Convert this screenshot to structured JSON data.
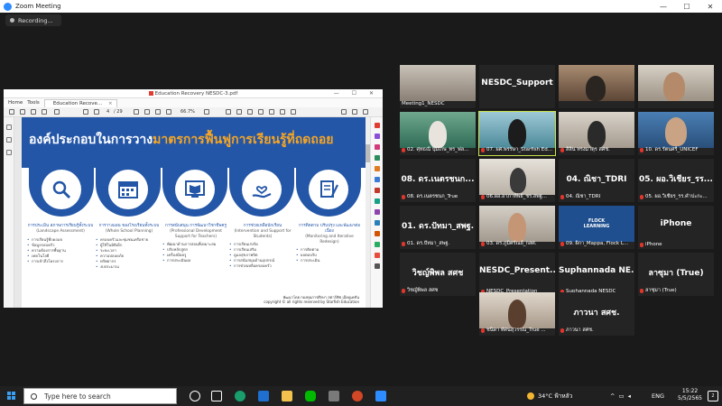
{
  "window": {
    "title": "Zoom Meeting",
    "recording_label": "Recording..."
  },
  "pdf": {
    "filename": "Education Recovery NESDC-3.pdf",
    "menu": [
      "Home",
      "Tools"
    ],
    "tab_label": "Education Recove...",
    "tab_close": "×",
    "page_current": "4",
    "page_total": "/ 29",
    "zoom": "66.7%"
  },
  "slide": {
    "title_prefix": "องค์ประกอบในการวาง",
    "title_highlight": "มาตรการฟื้นฟูการเรียนรู้ที่ถดถอย",
    "columns": [
      {
        "heading": "การประเมิน สภาพการเรียนรู้ทั้งระบบ",
        "sub": "(Landscape Assessment)",
        "items": [
          "การเรียนรู้ที่ถดถอย",
          "ข้อมูลรอบครัว",
          "ความต้องการพื้นฐาน",
          "เทคโนโลยี",
          "การเข้าถึงโครงการ"
        ]
      },
      {
        "heading": "การวางแผน ของโรงเรียนทั้งระบบ",
        "sub": "(Whole School Planning)",
        "items": [
          "ครอบครัวและชุมชนเครือข่าย",
          "ผู้ใช้ในมิติเด็ก",
          "ระยะเวลา",
          "ความปลอดภัย",
          "ทรัพยากร",
          "งบประมาณ"
        ]
      },
      {
        "heading": "การสนับสนุน การพัฒนาวิชาชีพครู",
        "sub": "(Professional Development Support for Teachers)",
        "items": [
          "พัฒนาด้านการสอนที่เหมาะสม",
          "ปรับหลักสูตร",
          "เครื่องมือครู",
          "การประเมินผล"
        ]
      },
      {
        "heading": "การช่วยเหลือนักเรียน",
        "sub": "(Intervention and Support for Students)",
        "items": [
          "การเรียนเร่งรัด",
          "การเรียนเสริม",
          "ดูแลสุขภาพจิต",
          "การสนับสนุนด้านอุปกรณ์",
          "การช่วยเหลือครอบครัว"
        ]
      },
      {
        "heading": "การติดตาม ปรับปรุง และพัฒนาต่อเนื่อง",
        "sub": "(Monitoring and Iterative Redesign)",
        "items": [
          "การติดตาม",
          "ผลตอบรับ",
          "การประเมิน"
        ]
      }
    ],
    "copyright": [
      "พัฒนาโดย กองทุนการศึกษา สตาร์ฟิช เอ็ดดูเคชั่น",
      "copyright © all rights reserved by Starfish Education"
    ]
  },
  "gallery": {
    "tiles": [
      {
        "name": "Meeting1_NESDC",
        "video": true,
        "big": ""
      },
      {
        "name": "",
        "video": false,
        "big": "NESDC_Support"
      },
      {
        "name": "",
        "video": true,
        "big": ""
      },
      {
        "name": "",
        "video": true,
        "big": ""
      },
      {
        "name": "02. ศุทธณี ปุ้มเกษ_ทร_ฟล...",
        "video": true,
        "big": "",
        "muted": true
      },
      {
        "name": "07. ผศ.พรรษา_Starfish Ed...",
        "video": true,
        "big": "",
        "muted": true
      },
      {
        "name": "สิลิน ทรงมาตุร สศช.",
        "video": true,
        "big": "",
        "muted": true
      },
      {
        "name": "10. ดร.รัตนศรี_UNICEF",
        "video": true,
        "big": "",
        "muted": true
      },
      {
        "name": "08. ดร.เนตรชนก_True",
        "video": false,
        "big": "08. ดร.เนตรชนก...",
        "muted": true
      },
      {
        "name": "06.ผอ.อาภาทิพย์_ชร.สพฐ...",
        "video": true,
        "big": "",
        "muted": true
      },
      {
        "name": "04. ณิชา_TDRI",
        "video": false,
        "big": "04. ณิชา_TDRI",
        "muted": true
      },
      {
        "name": "05. ผอ.วิเชียร_รร.คำปะกะ...",
        "video": false,
        "big": "05. ผอ.วิเชียร_รร...",
        "muted": true
      },
      {
        "name": "01. ดร.ปัทมา_สพฐ.",
        "video": false,
        "big": "01. ดร.ปัทมา_สพฐ.",
        "muted": true
      },
      {
        "name": "03. ดร.ภูมิศรัณย์_กสศ.",
        "video": true,
        "big": "",
        "muted": true
      },
      {
        "name": "09. ผิกา_Mappa, Flock L...",
        "video": true,
        "big": "",
        "muted": true
      },
      {
        "name": "iPhone",
        "video": false,
        "big": "iPhone",
        "muted": true
      },
      {
        "name": "วิชญ์พิพล สศช",
        "video": false,
        "big": "วิชญ์พิพล สศช",
        "muted": true
      },
      {
        "name": "NESDC_Presentation",
        "video": false,
        "big": "NESDC_Present...",
        "muted": true
      },
      {
        "name": "Suphannada NESDC",
        "video": false,
        "big": "Suphannada NE...",
        "muted": true
      },
      {
        "name": "ลาซุมา (True)",
        "video": false,
        "big": "ลาซุมา (True)",
        "muted": true
      },
      {
        "name": "ชนิดา ทัศนสุวรรณ_True ...",
        "video": true,
        "big": "",
        "muted": true
      },
      {
        "name": "ภาวนา สศช.",
        "video": false,
        "big": "ภาวนา สศช.",
        "muted": true
      }
    ],
    "flock_logo": "FLOCK LEARNING"
  },
  "taskbar": {
    "search_placeholder": "Type here to search",
    "weather": "34°C ฟ้าหลัว",
    "lang": "ENG",
    "time": "15:22",
    "date": "5/5/2565",
    "notifications": "2"
  }
}
